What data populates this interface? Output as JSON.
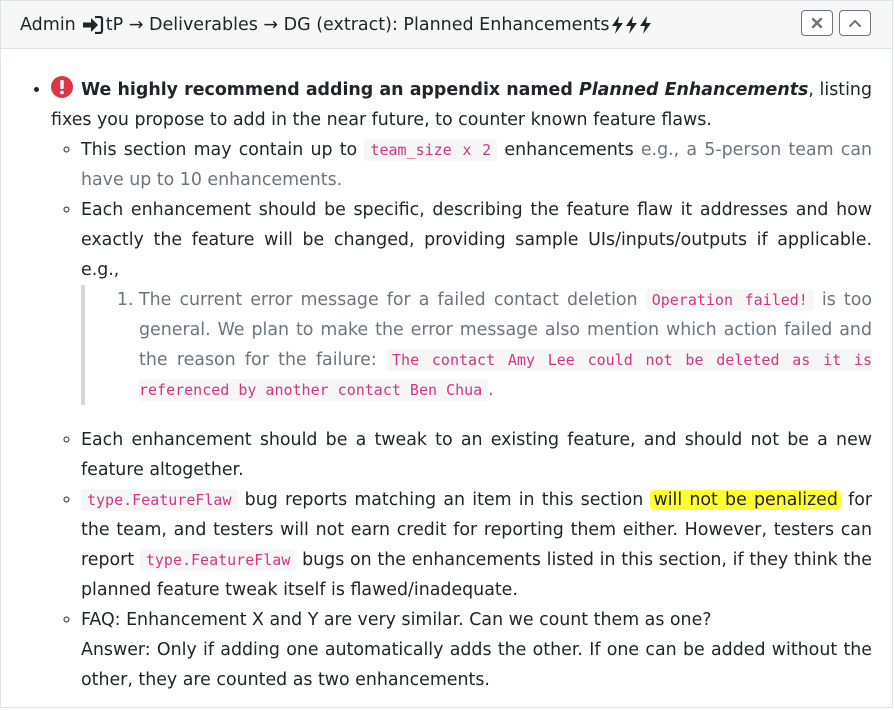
{
  "header": {
    "crumb_admin": "Admin",
    "crumb_rest": "tP → Deliverables → DG (extract): Planned Enhancements",
    "icons": [
      "sign-in-icon",
      "bolt-icon",
      "bolt-icon",
      "bolt-icon"
    ]
  },
  "body": {
    "lead_bold_1": "We highly recommend adding an appendix named ",
    "lead_bold_em": "Planned Enhancements",
    "lead_rest": ", listing fixes you propose to add in the near future, to counter known feature flaws.",
    "item1": {
      "a": "This section may contain up to ",
      "code": "team_size x 2",
      "b": " enhancements ",
      "muted": "e.g., a 5-person team can have up to 10 enhancements."
    },
    "item2": {
      "text": "Each enhancement should be specific, describing the feature flaw it addresses and how exactly the feature will be changed, providing sample UIs/inputs/outputs if applicable. e.g.,",
      "quote": {
        "a": "The current error message for a failed contact deletion ",
        "code1": "Operation failed!",
        "b": " is too general. We plan to make the error message also mention which action failed and the reason for the failure: ",
        "code2": "The contact Amy Lee could not be deleted as it is referenced by another contact Ben Chua",
        "c": "."
      }
    },
    "item3": "Each enhancement should be a tweak to an existing feature, and should not be a new feature altogether.",
    "item4": {
      "code1": "type.FeatureFlaw",
      "a": " bug reports matching an item in this section ",
      "highlight": "will not be penalized",
      "b": " for the team, and testers will not earn credit for reporting them either. However, testers can report ",
      "code2": "type.FeatureFlaw",
      "c": " bugs on the enhancements listed in this section, if they think the planned feature tweak itself is flawed/inadequate."
    },
    "item5": {
      "q": "FAQ: Enhancement X and Y are very similar. Can we count them as one?",
      "a": "Answer: Only if adding one automatically adds the other. If one can be added without the other, they are counted as two enhancements."
    }
  },
  "colors": {
    "header_bg": "#f7f7f7",
    "code": "#d63384",
    "highlight": "#ffff33",
    "alert": "#dc3545",
    "muted": "#6c757d"
  }
}
